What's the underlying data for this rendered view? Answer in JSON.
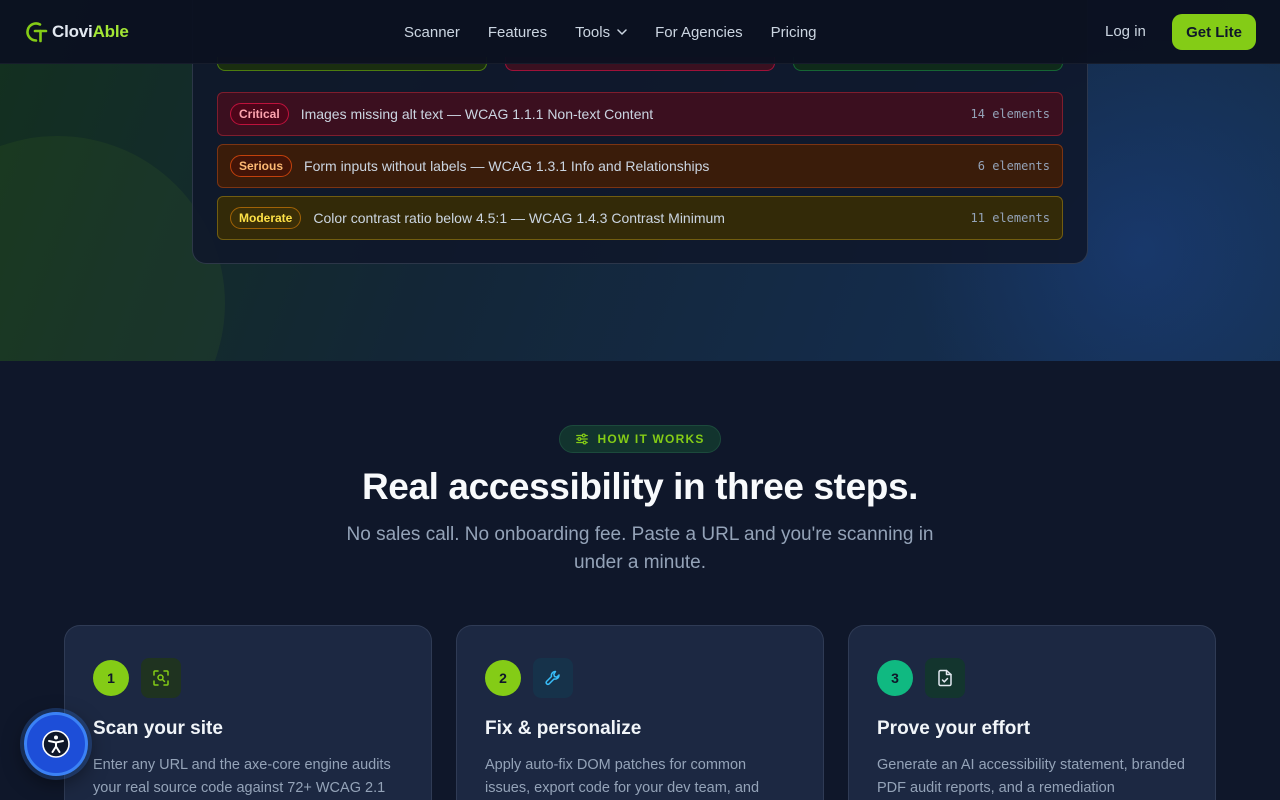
{
  "brand": {
    "name_part1": "Clovi",
    "name_part2": "Able",
    "accent": "#84cc16"
  },
  "nav": {
    "links": [
      "Scanner",
      "Features",
      "Tools",
      "For Agencies",
      "Pricing"
    ],
    "login": "Log in",
    "cta": "Get Lite"
  },
  "scan_results": {
    "issues": [
      {
        "severity": "Critical",
        "description": "Images missing alt text — WCAG 1.1.1 Non-text Content",
        "count": "14 elements"
      },
      {
        "severity": "Serious",
        "description": "Form inputs without labels — WCAG 1.3.1 Info and Relationships",
        "count": "6 elements"
      },
      {
        "severity": "Moderate",
        "description": "Color contrast ratio below 4.5:1 — WCAG 1.4.3 Contrast Minimum",
        "count": "11 elements"
      }
    ]
  },
  "how_it_works": {
    "badge": "HOW IT WORKS",
    "title": "Real accessibility in three steps.",
    "subtitle": "No sales call. No onboarding fee. Paste a URL and you're scanning in under a minute.",
    "steps": [
      {
        "number": "1",
        "icon": "scan-search-icon",
        "title": "Scan your site",
        "text": "Enter any URL and the axe-core engine audits your real source code against 72+ WCAG 2.1"
      },
      {
        "number": "2",
        "icon": "wrench-icon",
        "title": "Fix & personalize",
        "text": "Apply auto-fix DOM patches for common issues, export code for your dev team, and"
      },
      {
        "number": "3",
        "icon": "file-check-icon",
        "title": "Prove your effort",
        "text": "Generate an AI accessibility statement, branded PDF audit reports, and a remediation"
      }
    ]
  },
  "widget": {
    "icon": "accessibility-icon"
  }
}
